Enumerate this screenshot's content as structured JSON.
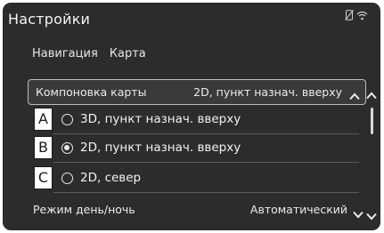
{
  "header": {
    "title": "Настройки",
    "status_icons": [
      "phone-off-icon",
      "wifi-icon"
    ]
  },
  "tabs": [
    {
      "label": "Навигация"
    },
    {
      "label": "Карта"
    }
  ],
  "map_layout": {
    "label": "Компоновка карты",
    "value": "2D, пункт назнач. вверху",
    "expanded": true
  },
  "options": [
    {
      "letter": "A",
      "label": "3D, пункт назнач. вверху",
      "selected": false
    },
    {
      "letter": "B",
      "label": "2D, пункт назнач. вверху",
      "selected": true
    },
    {
      "letter": "C",
      "label": "2D, север",
      "selected": false
    }
  ],
  "day_night": {
    "label": "Режим день/ночь",
    "value": "Автоматический"
  },
  "colors": {
    "background": "#2c2c2c",
    "text": "#f2f2f2",
    "callout_box": "#ffffff"
  }
}
